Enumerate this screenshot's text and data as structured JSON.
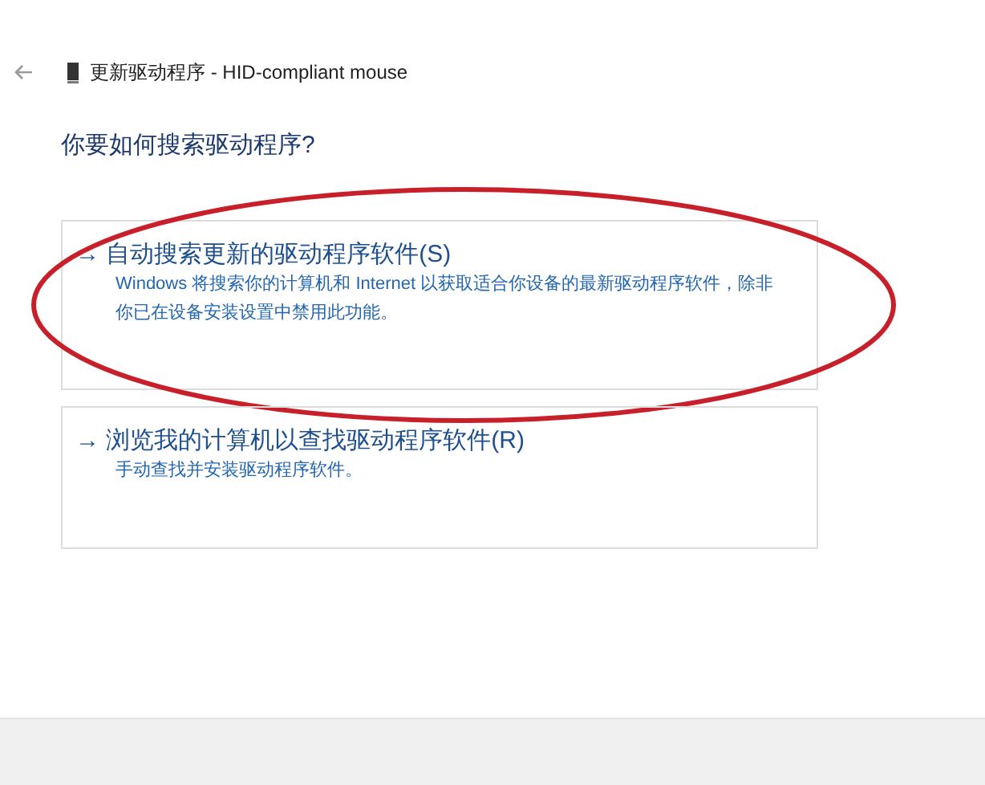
{
  "window": {
    "title": "更新驱动程序 - HID-compliant mouse"
  },
  "heading": "你要如何搜索驱动程序?",
  "options": [
    {
      "arrow": "→",
      "title": "自动搜索更新的驱动程序软件(S)",
      "description": "Windows 将搜索你的计算机和 Internet 以获取适合你设备的最新驱动程序软件，除非你已在设备安装设置中禁用此功能。",
      "highlighted": true
    },
    {
      "arrow": "→",
      "title": "浏览我的计算机以查找驱动程序软件(R)",
      "description": "手动查找并安装驱动程序软件。",
      "highlighted": false
    }
  ]
}
